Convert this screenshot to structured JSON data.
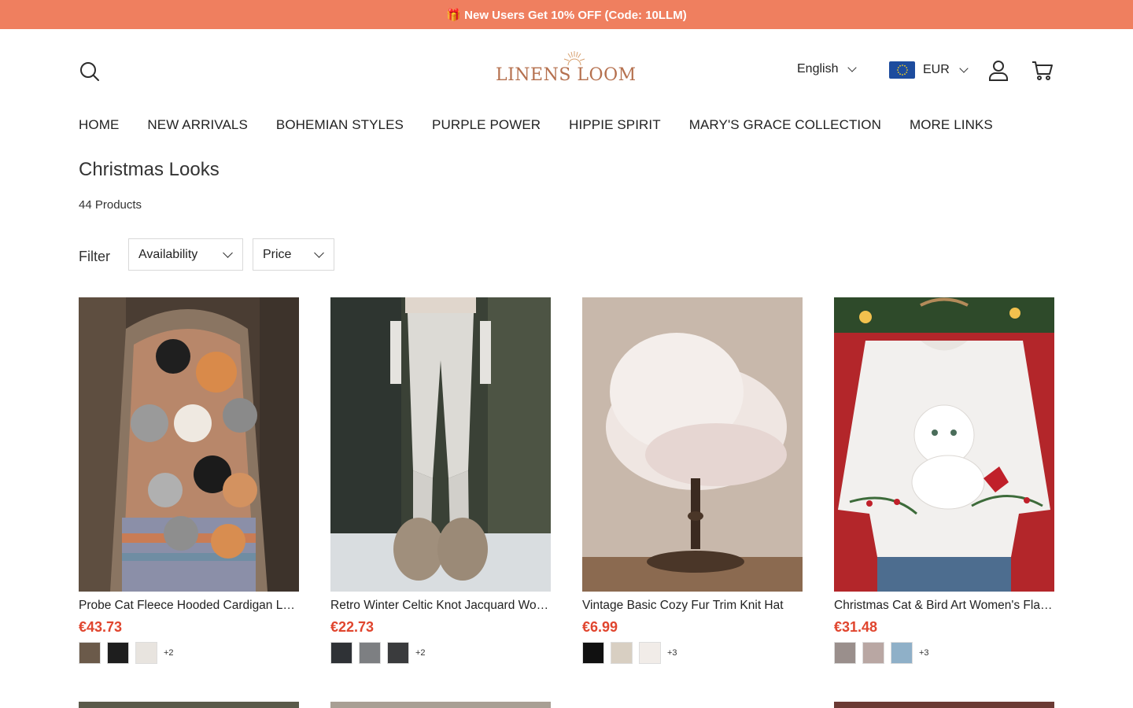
{
  "announcement": {
    "text": "🎁 New Users Get 10% OFF (Code: 10LLM)"
  },
  "header": {
    "logo_text": "LINENS LOOM",
    "language": "English",
    "currency": "EUR"
  },
  "nav": {
    "items": [
      "HOME",
      "NEW ARRIVALS",
      "BOHEMIAN STYLES",
      "PURPLE POWER",
      "HIPPIE SPIRIT",
      "MARY'S GRACE COLLECTION",
      "MORE LINKS"
    ]
  },
  "collection": {
    "title": "Christmas Looks",
    "count": "44 Products"
  },
  "filters": {
    "label": "Filter",
    "availability": "Availability",
    "price": "Price"
  },
  "products": [
    {
      "title": "Probe Cat Fleece Hooded Cardigan Loose Casual Coat",
      "price": "€43.73",
      "swatch_colors": [
        "#6b5a4a",
        "#1e1e1e",
        "#e8e4df"
      ],
      "more": "+2"
    },
    {
      "title": "Retro Winter Celtic Knot Jacquard Wool Leggings",
      "price": "€22.73",
      "swatch_colors": [
        "#2f3236",
        "#7d7f82",
        "#3a3b3d"
      ],
      "more": "+2"
    },
    {
      "title": "Vintage Basic Cozy Fur Trim Knit Hat",
      "price": "€6.99",
      "swatch_colors": [
        "#111111",
        "#d8cfc2",
        "#f1ece8"
      ],
      "more": "+3"
    },
    {
      "title": "Christmas Cat & Bird Art Women's Flannel Sweatshirt",
      "price": "€31.48",
      "swatch_colors": [
        "#9a8f8c",
        "#b9a7a3",
        "#8fb0c8"
      ],
      "more": "+3"
    }
  ]
}
